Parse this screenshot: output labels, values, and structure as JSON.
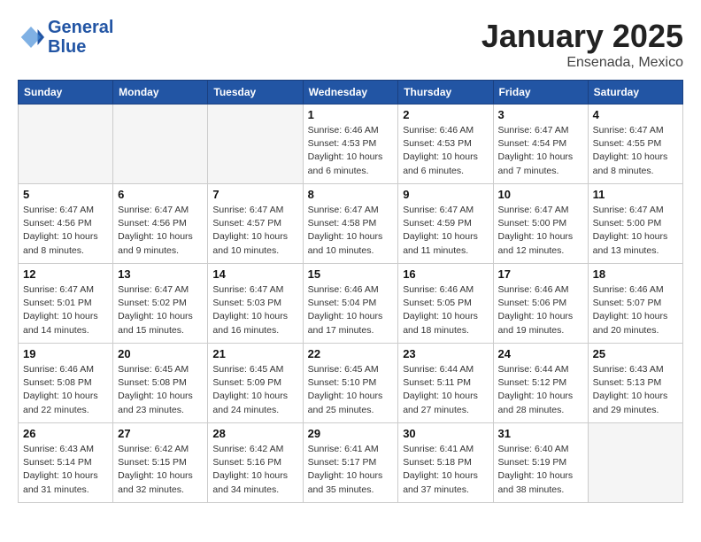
{
  "header": {
    "logo_line1": "General",
    "logo_line2": "Blue",
    "month": "January 2025",
    "location": "Ensenada, Mexico"
  },
  "weekdays": [
    "Sunday",
    "Monday",
    "Tuesday",
    "Wednesday",
    "Thursday",
    "Friday",
    "Saturday"
  ],
  "weeks": [
    [
      {
        "day": "",
        "info": ""
      },
      {
        "day": "",
        "info": ""
      },
      {
        "day": "",
        "info": ""
      },
      {
        "day": "1",
        "info": "Sunrise: 6:46 AM\nSunset: 4:53 PM\nDaylight: 10 hours\nand 6 minutes."
      },
      {
        "day": "2",
        "info": "Sunrise: 6:46 AM\nSunset: 4:53 PM\nDaylight: 10 hours\nand 6 minutes."
      },
      {
        "day": "3",
        "info": "Sunrise: 6:47 AM\nSunset: 4:54 PM\nDaylight: 10 hours\nand 7 minutes."
      },
      {
        "day": "4",
        "info": "Sunrise: 6:47 AM\nSunset: 4:55 PM\nDaylight: 10 hours\nand 8 minutes."
      }
    ],
    [
      {
        "day": "5",
        "info": "Sunrise: 6:47 AM\nSunset: 4:56 PM\nDaylight: 10 hours\nand 8 minutes."
      },
      {
        "day": "6",
        "info": "Sunrise: 6:47 AM\nSunset: 4:56 PM\nDaylight: 10 hours\nand 9 minutes."
      },
      {
        "day": "7",
        "info": "Sunrise: 6:47 AM\nSunset: 4:57 PM\nDaylight: 10 hours\nand 10 minutes."
      },
      {
        "day": "8",
        "info": "Sunrise: 6:47 AM\nSunset: 4:58 PM\nDaylight: 10 hours\nand 10 minutes."
      },
      {
        "day": "9",
        "info": "Sunrise: 6:47 AM\nSunset: 4:59 PM\nDaylight: 10 hours\nand 11 minutes."
      },
      {
        "day": "10",
        "info": "Sunrise: 6:47 AM\nSunset: 5:00 PM\nDaylight: 10 hours\nand 12 minutes."
      },
      {
        "day": "11",
        "info": "Sunrise: 6:47 AM\nSunset: 5:00 PM\nDaylight: 10 hours\nand 13 minutes."
      }
    ],
    [
      {
        "day": "12",
        "info": "Sunrise: 6:47 AM\nSunset: 5:01 PM\nDaylight: 10 hours\nand 14 minutes."
      },
      {
        "day": "13",
        "info": "Sunrise: 6:47 AM\nSunset: 5:02 PM\nDaylight: 10 hours\nand 15 minutes."
      },
      {
        "day": "14",
        "info": "Sunrise: 6:47 AM\nSunset: 5:03 PM\nDaylight: 10 hours\nand 16 minutes."
      },
      {
        "day": "15",
        "info": "Sunrise: 6:46 AM\nSunset: 5:04 PM\nDaylight: 10 hours\nand 17 minutes."
      },
      {
        "day": "16",
        "info": "Sunrise: 6:46 AM\nSunset: 5:05 PM\nDaylight: 10 hours\nand 18 minutes."
      },
      {
        "day": "17",
        "info": "Sunrise: 6:46 AM\nSunset: 5:06 PM\nDaylight: 10 hours\nand 19 minutes."
      },
      {
        "day": "18",
        "info": "Sunrise: 6:46 AM\nSunset: 5:07 PM\nDaylight: 10 hours\nand 20 minutes."
      }
    ],
    [
      {
        "day": "19",
        "info": "Sunrise: 6:46 AM\nSunset: 5:08 PM\nDaylight: 10 hours\nand 22 minutes."
      },
      {
        "day": "20",
        "info": "Sunrise: 6:45 AM\nSunset: 5:08 PM\nDaylight: 10 hours\nand 23 minutes."
      },
      {
        "day": "21",
        "info": "Sunrise: 6:45 AM\nSunset: 5:09 PM\nDaylight: 10 hours\nand 24 minutes."
      },
      {
        "day": "22",
        "info": "Sunrise: 6:45 AM\nSunset: 5:10 PM\nDaylight: 10 hours\nand 25 minutes."
      },
      {
        "day": "23",
        "info": "Sunrise: 6:44 AM\nSunset: 5:11 PM\nDaylight: 10 hours\nand 27 minutes."
      },
      {
        "day": "24",
        "info": "Sunrise: 6:44 AM\nSunset: 5:12 PM\nDaylight: 10 hours\nand 28 minutes."
      },
      {
        "day": "25",
        "info": "Sunrise: 6:43 AM\nSunset: 5:13 PM\nDaylight: 10 hours\nand 29 minutes."
      }
    ],
    [
      {
        "day": "26",
        "info": "Sunrise: 6:43 AM\nSunset: 5:14 PM\nDaylight: 10 hours\nand 31 minutes."
      },
      {
        "day": "27",
        "info": "Sunrise: 6:42 AM\nSunset: 5:15 PM\nDaylight: 10 hours\nand 32 minutes."
      },
      {
        "day": "28",
        "info": "Sunrise: 6:42 AM\nSunset: 5:16 PM\nDaylight: 10 hours\nand 34 minutes."
      },
      {
        "day": "29",
        "info": "Sunrise: 6:41 AM\nSunset: 5:17 PM\nDaylight: 10 hours\nand 35 minutes."
      },
      {
        "day": "30",
        "info": "Sunrise: 6:41 AM\nSunset: 5:18 PM\nDaylight: 10 hours\nand 37 minutes."
      },
      {
        "day": "31",
        "info": "Sunrise: 6:40 AM\nSunset: 5:19 PM\nDaylight: 10 hours\nand 38 minutes."
      },
      {
        "day": "",
        "info": ""
      }
    ]
  ]
}
